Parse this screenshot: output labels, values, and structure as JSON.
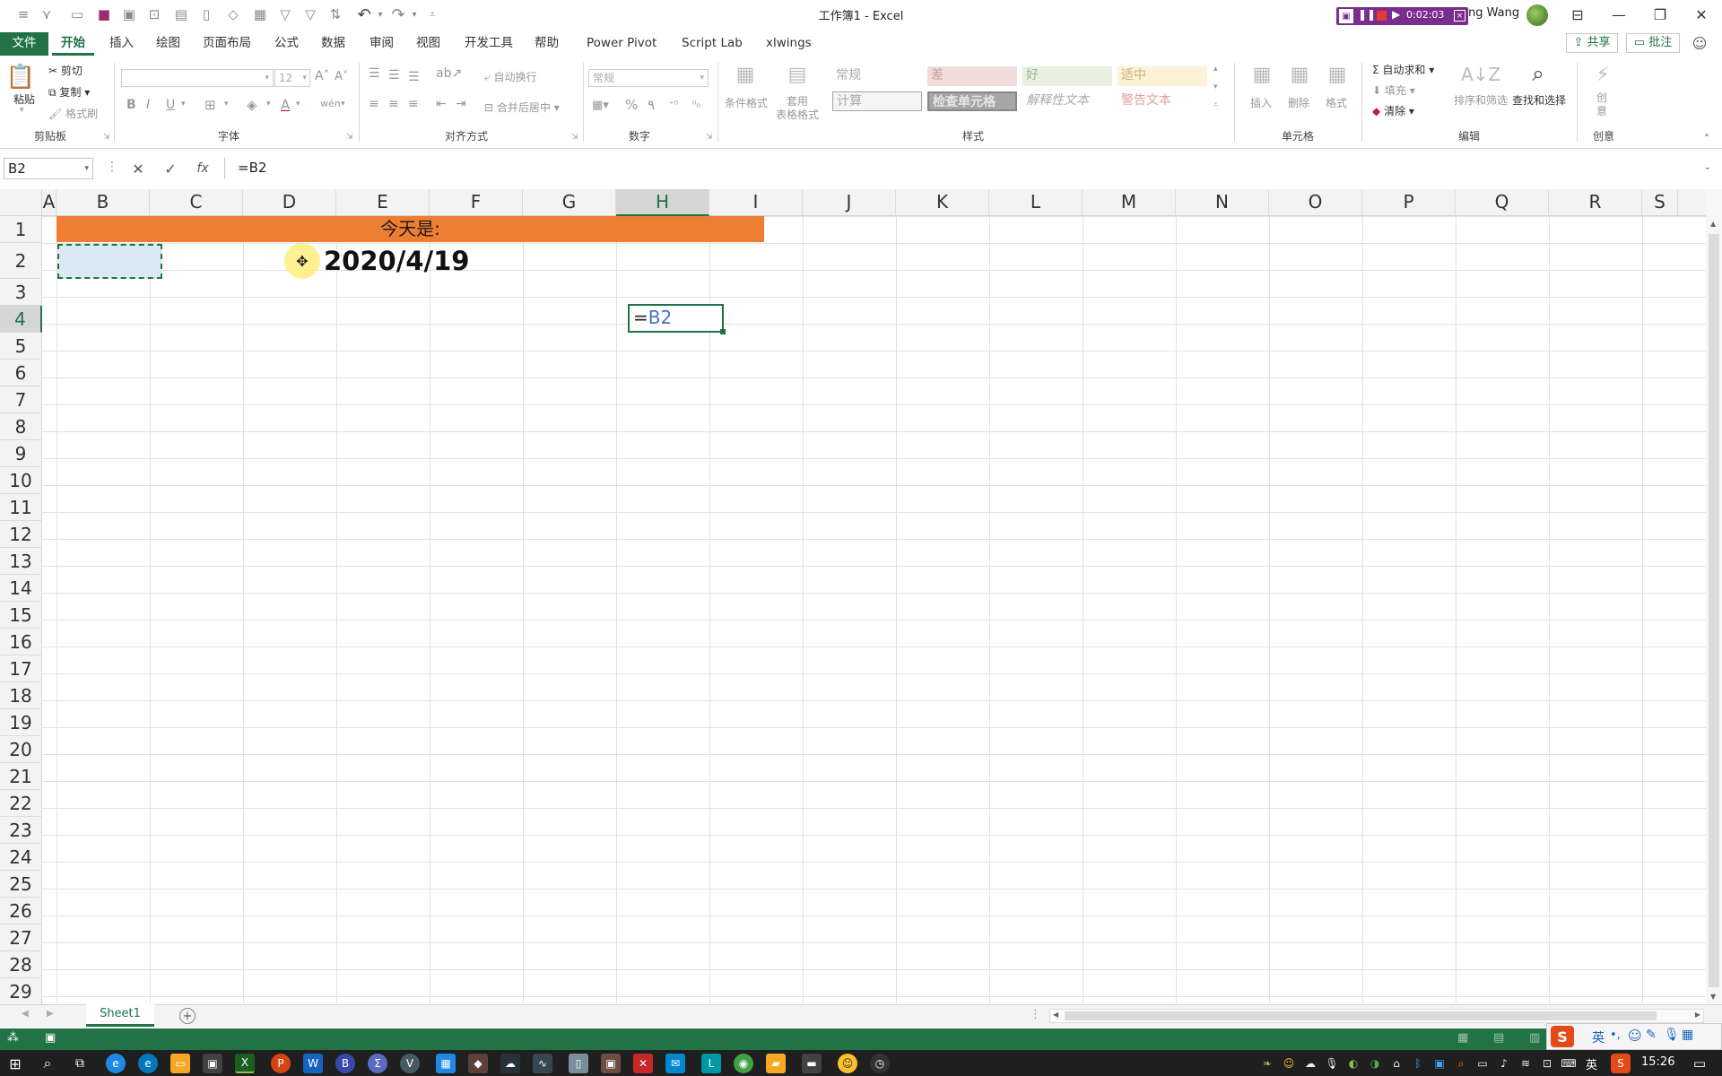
{
  "window": {
    "title": "工作簿1  -  Excel",
    "user": "ng Wang",
    "timer": "0:02:03"
  },
  "tabs": [
    "文件",
    "开始",
    "插入",
    "绘图",
    "页面布局",
    "公式",
    "数据",
    "审阅",
    "视图",
    "开发工具",
    "帮助",
    "Power Pivot",
    "Script Lab",
    "xlwings"
  ],
  "share_label": "共享",
  "comments_label": "批注",
  "ribbon": {
    "clipboard": {
      "paste": "粘贴",
      "cut": "剪切",
      "copy": "复制",
      "format_painter": "格式刷",
      "label": "剪贴板"
    },
    "font": {
      "size": "12",
      "bold": "B",
      "italic": "I",
      "underline": "U",
      "label": "字体"
    },
    "alignment": {
      "wrap": "自动换行",
      "merge": "合并后居中",
      "label": "对齐方式"
    },
    "number": {
      "format": "常规",
      "label": "数字"
    },
    "styles": {
      "conditional": "条件格式",
      "table": "套用\n表格格式",
      "cells": [
        "常规",
        "差",
        "好",
        "适中",
        "计算",
        "检查单元格",
        "解释性文本",
        "警告文本"
      ],
      "label": "样式"
    },
    "cells": {
      "insert": "插入",
      "delete": "删除",
      "format": "格式",
      "label": "单元格"
    },
    "editing": {
      "autosum": "自动求和",
      "fill": "填充",
      "clear": "清除",
      "sort": "排序和筛选",
      "find": "查找和选择",
      "label": "编辑"
    },
    "ideas": {
      "label": "创意",
      "btn": "创\n意"
    }
  },
  "formula_bar": {
    "name_box": "B2",
    "formula": "=B2",
    "fx": "fx"
  },
  "columns": [
    "A",
    "B",
    "C",
    "D",
    "E",
    "F",
    "G",
    "H",
    "I",
    "J",
    "K",
    "L",
    "M",
    "N",
    "O",
    "P",
    "Q",
    "R",
    "S"
  ],
  "rows": [
    "1",
    "2",
    "3",
    "4",
    "5",
    "6",
    "7",
    "8",
    "9",
    "10",
    "11",
    "12",
    "13",
    "14",
    "15",
    "16",
    "17",
    "18",
    "19",
    "20",
    "21",
    "22",
    "23",
    "24",
    "25",
    "26",
    "27",
    "28",
    "29"
  ],
  "cells": {
    "banner": "今天是:",
    "date": "2020/4/19",
    "editing_eq": "=",
    "editing_ref": "B2"
  },
  "sheet_tab": "Sheet1",
  "taskbar": {
    "time": "15:26",
    "ime": "英"
  },
  "colors": {
    "excel_green": "#217346",
    "banner_orange": "#ED7D31",
    "ref_blue": "#4472C4"
  }
}
